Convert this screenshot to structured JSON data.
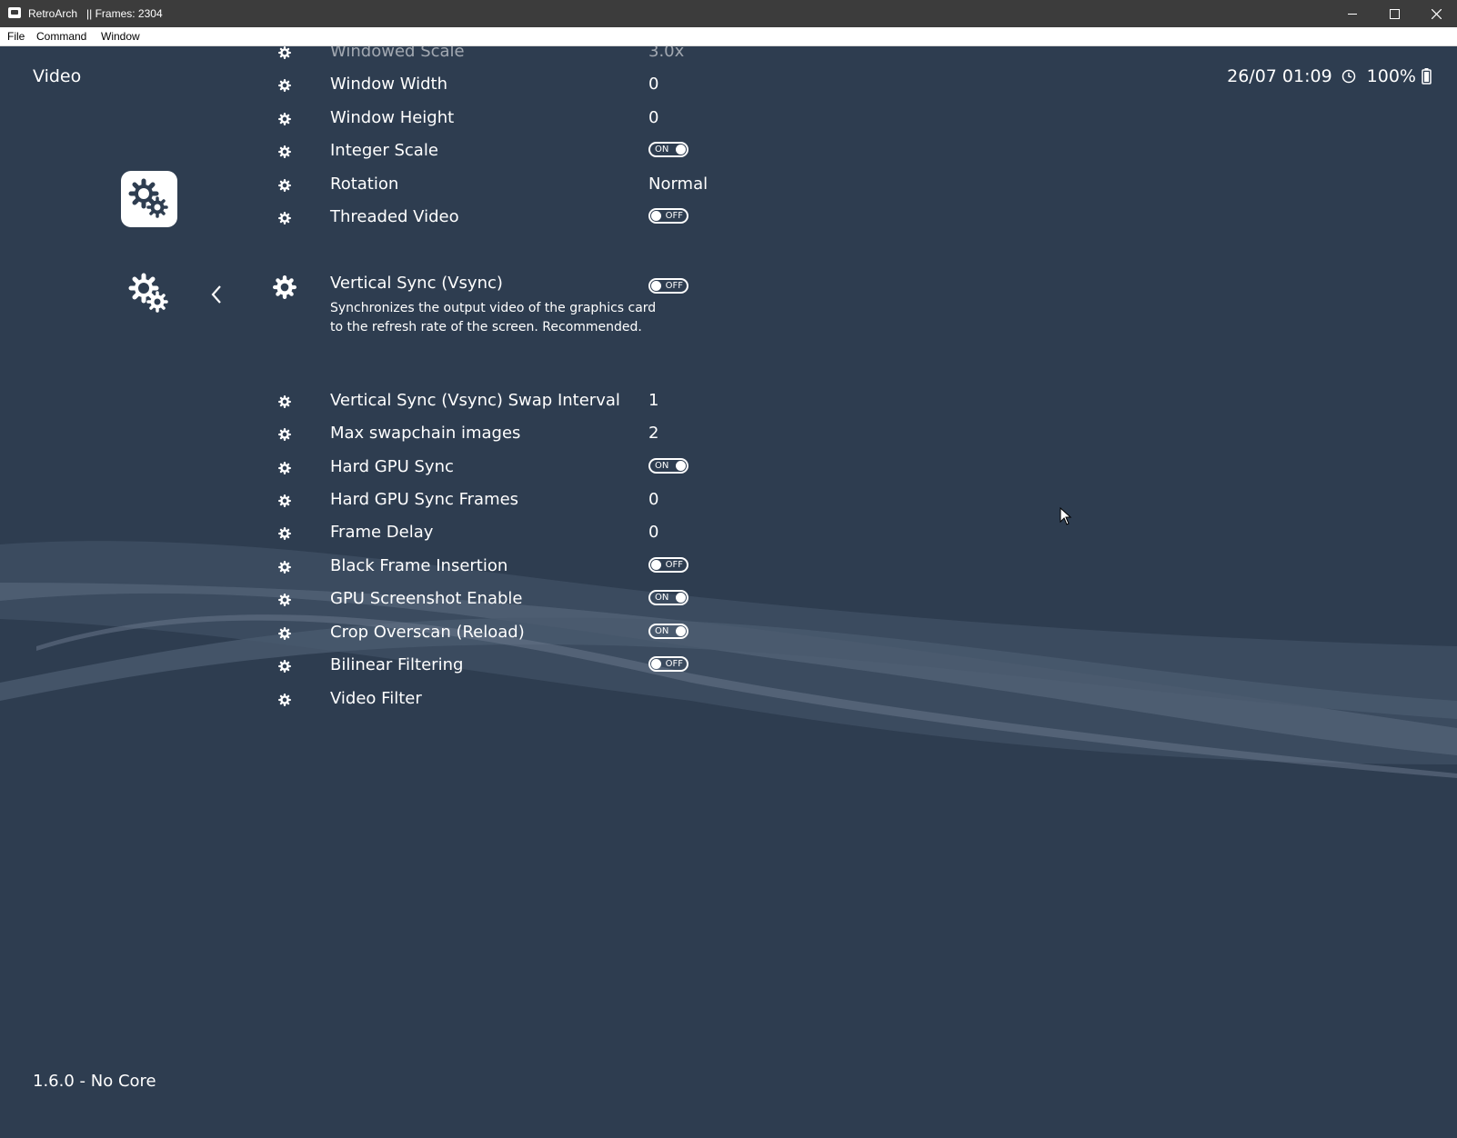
{
  "window": {
    "title": "RetroArch   || Frames: 2304",
    "controls": {
      "minimize": "minimize-icon",
      "maximize": "maximize-icon",
      "close": "close-icon"
    }
  },
  "menubar": {
    "items": [
      "File",
      "Command",
      "Window"
    ]
  },
  "header": {
    "title": "Video",
    "datetime": "26/07 01:09",
    "battery": "100%"
  },
  "colors": {
    "background": "#2e3d50",
    "text": "#ffffff",
    "titlebar": "#3c3c3c"
  },
  "settings": [
    {
      "label": "Windowed Scale",
      "value": "3.0x",
      "type": "value"
    },
    {
      "label": "Window Width",
      "value": "0",
      "type": "value"
    },
    {
      "label": "Window Height",
      "value": "0",
      "type": "value"
    },
    {
      "label": "Integer Scale",
      "value": "ON",
      "type": "toggle"
    },
    {
      "label": "Rotation",
      "value": "Normal",
      "type": "value"
    },
    {
      "label": "Threaded Video",
      "value": "OFF",
      "type": "toggle"
    },
    {
      "label": "Vertical Sync (Vsync)",
      "value": "OFF",
      "type": "toggle",
      "selected": true,
      "sublabel": "Synchronizes the output video of the graphics card to the refresh rate of the screen. Recommended."
    },
    {
      "label": "Vertical Sync (Vsync) Swap Interval",
      "value": "1",
      "type": "value"
    },
    {
      "label": "Max swapchain images",
      "value": "2",
      "type": "value"
    },
    {
      "label": "Hard GPU Sync",
      "value": "ON",
      "type": "toggle"
    },
    {
      "label": "Hard GPU Sync Frames",
      "value": "0",
      "type": "value"
    },
    {
      "label": "Frame Delay",
      "value": "0",
      "type": "value"
    },
    {
      "label": "Black Frame Insertion",
      "value": "OFF",
      "type": "toggle"
    },
    {
      "label": "GPU Screenshot Enable",
      "value": "ON",
      "type": "toggle"
    },
    {
      "label": "Crop Overscan (Reload)",
      "value": "ON",
      "type": "toggle"
    },
    {
      "label": "Bilinear Filtering",
      "value": "OFF",
      "type": "toggle"
    },
    {
      "label": "Video Filter",
      "value": "",
      "type": "value"
    }
  ],
  "footer": {
    "version": "1.6.0 - No Core"
  }
}
